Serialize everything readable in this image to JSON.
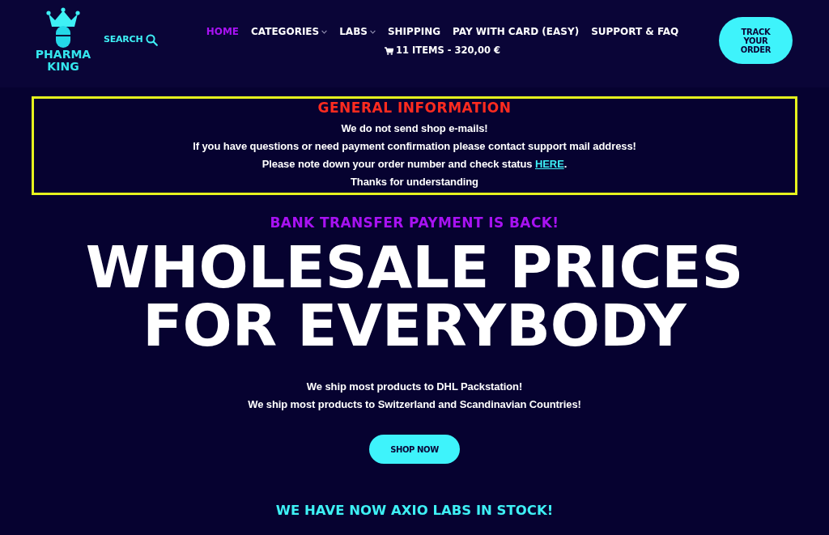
{
  "header": {
    "logo": {
      "text": "PHARMA KING"
    },
    "search": {
      "label": "SEARCH"
    },
    "nav": [
      {
        "label": "HOME",
        "selected": true,
        "dropdown": false
      },
      {
        "label": "CATEGORIES",
        "selected": false,
        "dropdown": true
      },
      {
        "label": "LABS",
        "selected": false,
        "dropdown": true
      },
      {
        "label": "SHIPPING",
        "selected": false,
        "dropdown": false
      },
      {
        "label": "PAY WITH CARD (EASY)",
        "selected": false,
        "dropdown": false
      },
      {
        "label": "SUPPORT & FAQ",
        "selected": false,
        "dropdown": false
      }
    ],
    "cart": {
      "text": "11 ITEMS - 320,00 €"
    },
    "track_button": {
      "label": "TRACK YOUR ORDER"
    }
  },
  "info_box": {
    "title": "GENERAL INFORMATION",
    "lines": [
      {
        "kind": "text",
        "text": "We do not send shop e-mails!"
      },
      {
        "kind": "text",
        "text": "If you have questions or need payment confirmation please contact support mail address!"
      },
      {
        "kind": "link",
        "text": "Please note down your order number and check status",
        "link": "HERE",
        "after": "."
      },
      {
        "kind": "text",
        "text": "Thanks for understanding"
      }
    ]
  },
  "hero": {
    "kicker": "BANK TRANSFER PAYMENT IS BACK!",
    "headline": [
      "WHOLESALE PRICES",
      "FOR EVERYBODY"
    ],
    "lines": [
      "We ship most products to DHL Packstation!",
      "We ship most products to Switzerland and Scandinavian Countries!"
    ],
    "button": {
      "label": "SHOP NOW"
    },
    "announcement": "WE HAVE NOW AXIO LABS IN STOCK!"
  }
}
